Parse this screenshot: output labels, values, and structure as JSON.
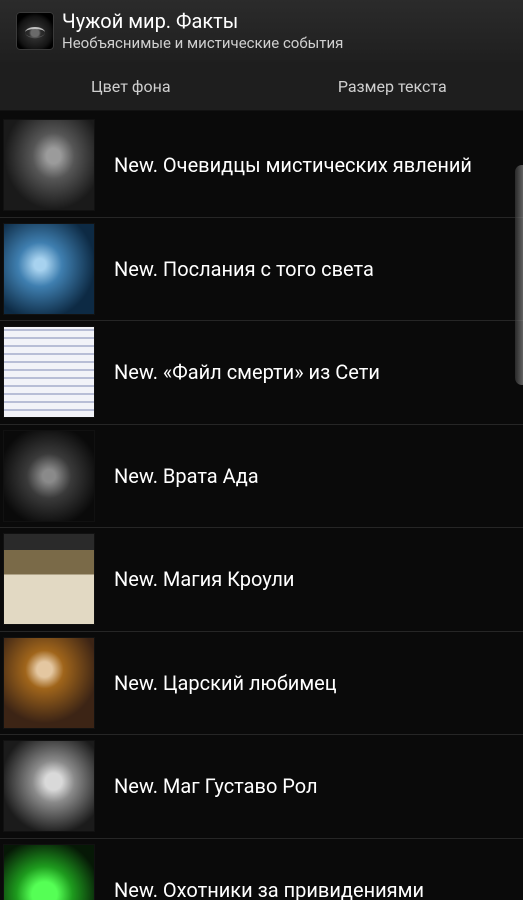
{
  "app": {
    "title": "Чужой мир. Факты",
    "subtitle": "Необъяснимые и мистические события"
  },
  "toolbar": {
    "bg_color_label": "Цвет фона",
    "text_size_label": "Размер текста"
  },
  "list": {
    "items": [
      {
        "label": "New. Очевидцы мистических явлений"
      },
      {
        "label": "New. Послания с того света"
      },
      {
        "label": "New. «Файл смерти» из Сети"
      },
      {
        "label": "New. Врата Ада"
      },
      {
        "label": "New. Магия Кроули"
      },
      {
        "label": "New. Царский любимец"
      },
      {
        "label": "New. Маг Густаво Рол"
      },
      {
        "label": "New. Охотники за привидениями"
      }
    ]
  }
}
